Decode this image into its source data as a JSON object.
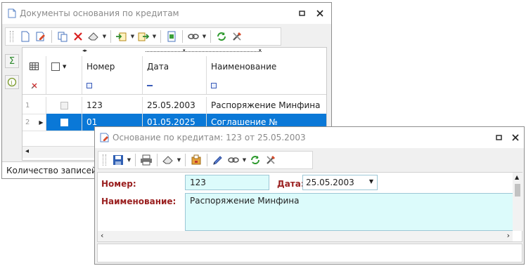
{
  "colors": {
    "accent": "#0a78d7",
    "label_red": "#9a2020",
    "field_bg": "#dcfbfb"
  },
  "back_window": {
    "title": "Документы основания по кредитам",
    "icons": {
      "title": "document-icon",
      "restore": "restore-icon",
      "close": "close-icon"
    },
    "toolbar_icons": [
      "new-document-icon",
      "edit-icon",
      "copy-icon",
      "delete-icon",
      "eraser-icon",
      "import-icon",
      "export-icon",
      "report-icon",
      "link-icon",
      "refresh-icon",
      "settings-icon"
    ],
    "side_buttons": [
      "sum-icon",
      "info-icon"
    ],
    "grid": {
      "columns": [
        "Номер",
        "Дата",
        "Наименование"
      ],
      "rows": [
        {
          "num": "1",
          "number": "123",
          "date": "25.05.2003",
          "name": "Распоряжение Минфина"
        },
        {
          "num": "2",
          "number": "01",
          "date": "01.05.2025",
          "name": "Соглашение №_______"
        }
      ]
    },
    "status": "Количество записей:"
  },
  "front_window": {
    "title": "Основание по кредитам: 123 от 25.05.2003",
    "icons": {
      "title": "edit-document-icon",
      "restore": "restore-icon",
      "close": "close-icon"
    },
    "toolbar_icons": [
      "save-icon",
      "print-icon",
      "eraser-icon",
      "attach-icon",
      "pen-icon",
      "link-icon",
      "refresh-icon",
      "settings-icon"
    ],
    "fields": {
      "number_label": "Номер:",
      "number_value": "123",
      "date_label": "Дата:",
      "date_value": "25.05.2003",
      "name_label": "Наименование:",
      "name_value": "Распоряжение Минфина"
    }
  }
}
